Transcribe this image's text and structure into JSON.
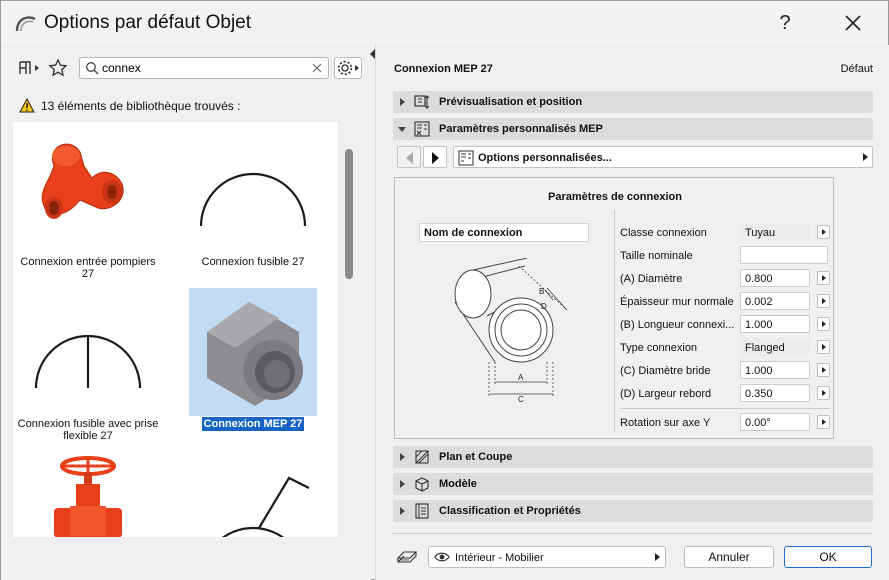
{
  "window": {
    "title": "Options par défaut Objet",
    "help": "?"
  },
  "left": {
    "search_value": "connex",
    "found_text": "13 éléments de bibliothèque trouvés :",
    "items": [
      {
        "label": "Connexion entrée pompiers 27"
      },
      {
        "label": "Connexion fusible 27"
      },
      {
        "label": "Connexion fusible avec prise flexible 27"
      },
      {
        "label": "Connexion MEP 27",
        "selected": true
      },
      {
        "label": ""
      },
      {
        "label": ""
      }
    ]
  },
  "right": {
    "title": "Connexion MEP 27",
    "default_label": "Défaut",
    "sections": [
      {
        "label": "Prévisualisation et position",
        "icon": "preview-icon",
        "open": false
      },
      {
        "label": "Paramètres personnalisés MEP",
        "icon": "mep-params-icon",
        "open": true
      },
      {
        "label": "Plan et Coupe",
        "icon": "plan-section-icon",
        "open": false
      },
      {
        "label": "Modèle",
        "icon": "model-icon",
        "open": false
      },
      {
        "label": "Classification et Propriétés",
        "icon": "classification-icon",
        "open": false
      }
    ],
    "options_dropdown": "Options personnalisées...",
    "params": {
      "title": "Paramètres de connexion",
      "connection_name": "Nom de connexion",
      "diagram_labels": {
        "a": "A",
        "b": "B",
        "c": "C",
        "d": "D"
      },
      "rows": [
        {
          "label": "Classe connexion",
          "value": "Tuyau",
          "readonly": true,
          "arrow": true
        },
        {
          "label": "Taille nominale",
          "value": "",
          "readonly": false,
          "arrow": false
        },
        {
          "label": "(A) Diamètre",
          "value": "0.800",
          "readonly": false,
          "arrow": true
        },
        {
          "label": "Épaisseur mur normale",
          "value": "0.002",
          "readonly": false,
          "arrow": true
        },
        {
          "label": "(B) Longueur connexi...",
          "value": "1.000",
          "readonly": false,
          "arrow": true
        },
        {
          "label": "Type connexion",
          "value": "Flanged",
          "readonly": true,
          "arrow": true
        },
        {
          "label": "(C) Diamètre bride",
          "value": "1.000",
          "readonly": false,
          "arrow": true
        },
        {
          "label": "(D) Largeur rebord",
          "value": "0.350",
          "readonly": false,
          "arrow": true
        },
        {
          "label": "Rotation sur axe Y",
          "value": "0.00°",
          "readonly": false,
          "arrow": true
        }
      ]
    },
    "layer": "Intérieur - Mobilier",
    "cancel_label": "Annuler",
    "ok_label": "OK"
  },
  "colors": {
    "accent": "#1664c4",
    "selection_bg": "#c4dcf3",
    "pipe_red": "#e8401a",
    "pipe_grey": "#8c8c90"
  }
}
